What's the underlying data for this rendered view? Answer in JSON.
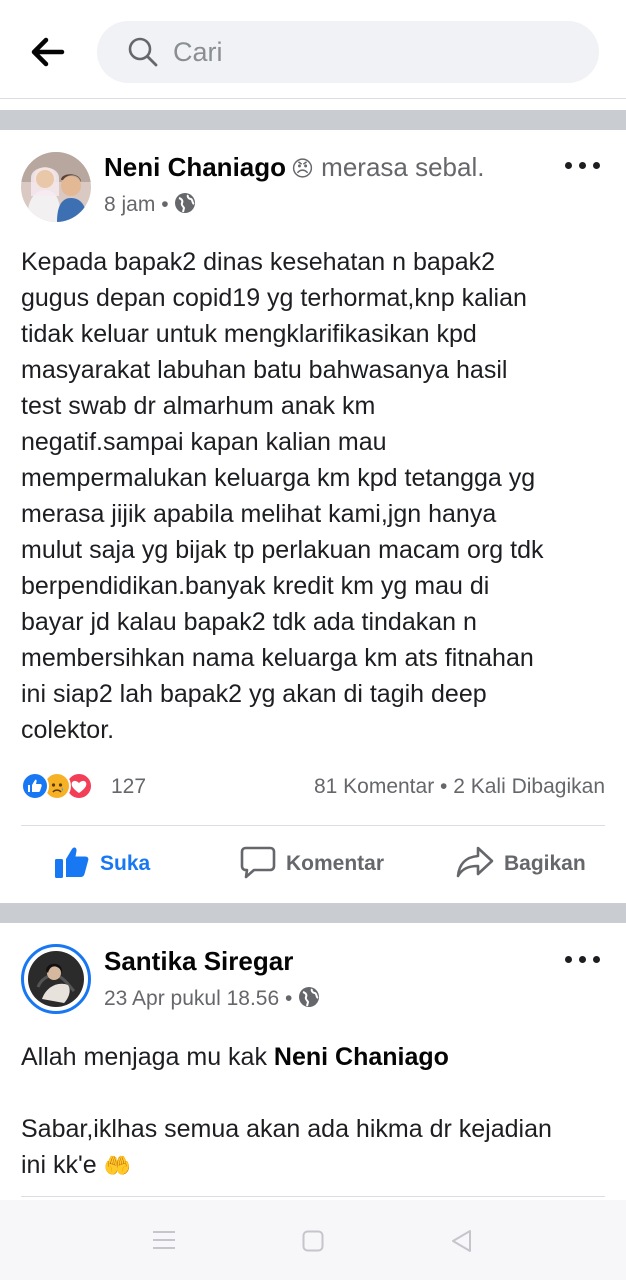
{
  "header": {
    "search_placeholder": "Cari"
  },
  "post": {
    "author": "Neni Chaniago",
    "feeling_emoji": "😠",
    "feeling_text": "merasa sebal.",
    "time": "8 jam",
    "privacy_icon": "globe-icon",
    "body": "Kepada bapak2 dinas kesehatan n bapak2\ngugus depan copid19 yg terhormat,knp kalian\ntidak keluar untuk mengklarifikasikan kpd\nmasyarakat labuhan batu bahwasanya hasil\ntest swab dr almarhum anak km\nnegatif.sampai kapan kalian mau\nmempermalukan keluarga km kpd tetangga yg\nmerasa jijik apabila melihat kami,jgn hanya\nmulut saja yg bijak tp perlakuan macam org tdk\nberpendidikan.banyak kredit km yg mau di\nbayar jd kalau bapak2 tdk ada tindakan n\nmembersihkan nama keluarga km ats fitnahan\nini siap2 lah bapak2 yg akan di tagih deep\ncolektor.",
    "reaction_count": "127",
    "comments": "81 Komentar",
    "shares": "2 Kali Dibagikan",
    "actions": {
      "like": "Suka",
      "comment": "Komentar",
      "share": "Bagikan"
    }
  },
  "comment": {
    "author": "Santika Siregar",
    "time": "23 Apr pukul 18.56",
    "line1_prefix": "Allah menjaga mu kak ",
    "line1_mention": "Neni Chaniago",
    "line2": "Sabar,iklhas semua akan ada hikma dr kejadian\nini kk'e",
    "emoji": "🤲"
  },
  "colors": {
    "accent": "#1877f2",
    "like_blue": "#1877f2",
    "love_red": "#f33e58",
    "divider": "#c9ccd1"
  }
}
